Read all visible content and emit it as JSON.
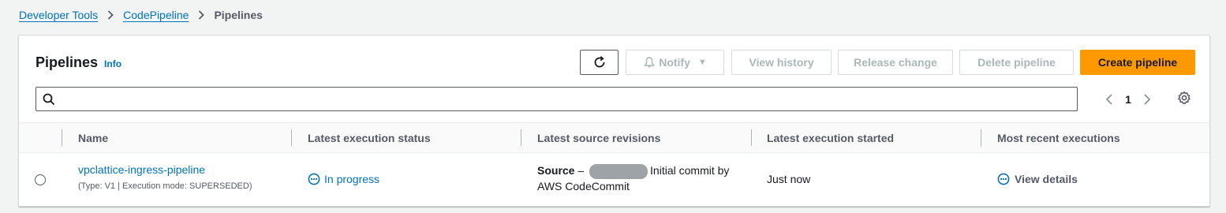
{
  "breadcrumb": {
    "items": [
      "Developer Tools",
      "CodePipeline"
    ],
    "current": "Pipelines"
  },
  "panel": {
    "title": "Pipelines",
    "info_link": "Info"
  },
  "toolbar": {
    "refresh_icon": "refresh-icon",
    "notify_label": "Notify",
    "view_history_label": "View history",
    "release_change_label": "Release change",
    "delete_pipeline_label": "Delete pipeline",
    "create_pipeline_label": "Create pipeline"
  },
  "search": {
    "placeholder": "",
    "value": ""
  },
  "pagination": {
    "current_page": "1"
  },
  "table": {
    "columns": [
      "Name",
      "Latest execution status",
      "Latest source revisions",
      "Latest execution started",
      "Most recent executions"
    ],
    "rows": [
      {
        "name": "vpclattice-ingress-pipeline",
        "meta": "(Type: V1 | Execution mode: SUPERSEDED)",
        "status": "In progress",
        "source_label": "Source",
        "source_prefix": " – ",
        "source_text": "Initial commit by",
        "source_text2": "AWS CodeCommit",
        "started": "Just now",
        "recent": "View details"
      }
    ]
  },
  "colors": {
    "link": "#0073bb",
    "primary_button": "#ff9900",
    "disabled_text": "#aab7b8",
    "background": "#f2f3f3"
  }
}
